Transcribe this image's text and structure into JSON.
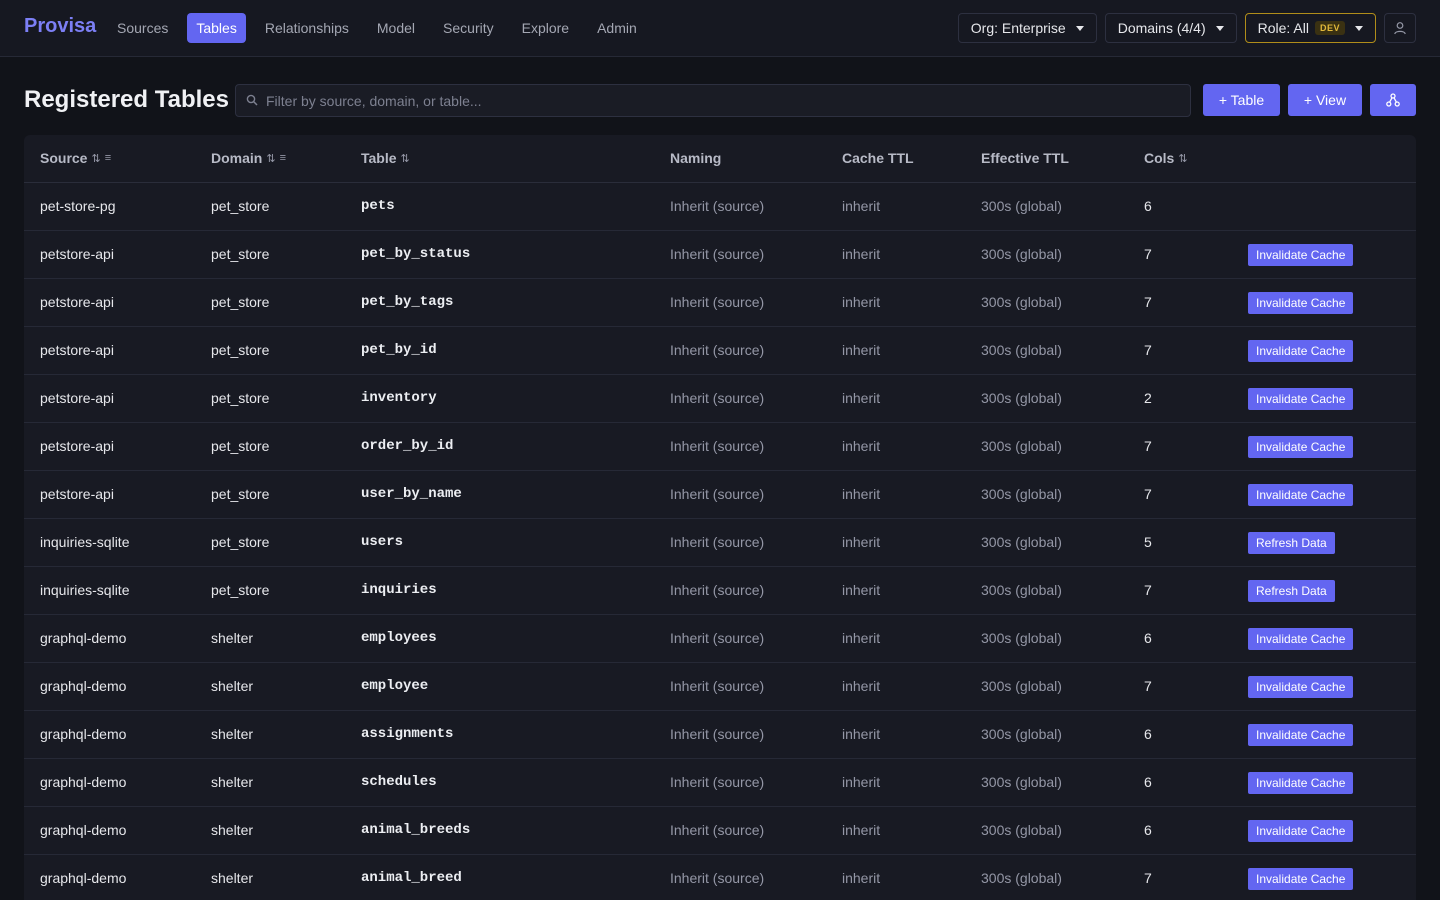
{
  "brand": "Provisa",
  "nav": [
    {
      "label": "Sources",
      "active": false
    },
    {
      "label": "Tables",
      "active": true
    },
    {
      "label": "Relationships",
      "active": false
    },
    {
      "label": "Model",
      "active": false
    },
    {
      "label": "Security",
      "active": false
    },
    {
      "label": "Explore",
      "active": false
    },
    {
      "label": "Admin",
      "active": false
    }
  ],
  "topbar": {
    "org_label": "Org: Enterprise",
    "domains_label": "Domains (4/4)",
    "role_label": "Role: All",
    "env_badge": "DEV"
  },
  "page": {
    "title": "Registered Tables",
    "filter_placeholder": "Filter by source, domain, or table...",
    "add_table_label": "+ Table",
    "add_view_label": "+ View"
  },
  "columns": {
    "source": "Source",
    "domain": "Domain",
    "table": "Table",
    "naming": "Naming",
    "cache_ttl": "Cache TTL",
    "effective_ttl": "Effective TTL",
    "cols": "Cols"
  },
  "rows": [
    {
      "source": "pet-store-pg",
      "domain": "pet_store",
      "table": "pets",
      "naming": "Inherit (source)",
      "cache_ttl": "inherit",
      "effective_ttl": "300s (global)",
      "cols": "6",
      "action": ""
    },
    {
      "source": "petstore-api",
      "domain": "pet_store",
      "table": "pet_by_status",
      "naming": "Inherit (source)",
      "cache_ttl": "inherit",
      "effective_ttl": "300s (global)",
      "cols": "7",
      "action": "Invalidate Cache"
    },
    {
      "source": "petstore-api",
      "domain": "pet_store",
      "table": "pet_by_tags",
      "naming": "Inherit (source)",
      "cache_ttl": "inherit",
      "effective_ttl": "300s (global)",
      "cols": "7",
      "action": "Invalidate Cache"
    },
    {
      "source": "petstore-api",
      "domain": "pet_store",
      "table": "pet_by_id",
      "naming": "Inherit (source)",
      "cache_ttl": "inherit",
      "effective_ttl": "300s (global)",
      "cols": "7",
      "action": "Invalidate Cache"
    },
    {
      "source": "petstore-api",
      "domain": "pet_store",
      "table": "inventory",
      "naming": "Inherit (source)",
      "cache_ttl": "inherit",
      "effective_ttl": "300s (global)",
      "cols": "2",
      "action": "Invalidate Cache"
    },
    {
      "source": "petstore-api",
      "domain": "pet_store",
      "table": "order_by_id",
      "naming": "Inherit (source)",
      "cache_ttl": "inherit",
      "effective_ttl": "300s (global)",
      "cols": "7",
      "action": "Invalidate Cache"
    },
    {
      "source": "petstore-api",
      "domain": "pet_store",
      "table": "user_by_name",
      "naming": "Inherit (source)",
      "cache_ttl": "inherit",
      "effective_ttl": "300s (global)",
      "cols": "7",
      "action": "Invalidate Cache"
    },
    {
      "source": "inquiries-sqlite",
      "domain": "pet_store",
      "table": "users",
      "naming": "Inherit (source)",
      "cache_ttl": "inherit",
      "effective_ttl": "300s (global)",
      "cols": "5",
      "action": "Refresh Data"
    },
    {
      "source": "inquiries-sqlite",
      "domain": "pet_store",
      "table": "inquiries",
      "naming": "Inherit (source)",
      "cache_ttl": "inherit",
      "effective_ttl": "300s (global)",
      "cols": "7",
      "action": "Refresh Data"
    },
    {
      "source": "graphql-demo",
      "domain": "shelter",
      "table": "employees",
      "naming": "Inherit (source)",
      "cache_ttl": "inherit",
      "effective_ttl": "300s (global)",
      "cols": "6",
      "action": "Invalidate Cache"
    },
    {
      "source": "graphql-demo",
      "domain": "shelter",
      "table": "employee",
      "naming": "Inherit (source)",
      "cache_ttl": "inherit",
      "effective_ttl": "300s (global)",
      "cols": "7",
      "action": "Invalidate Cache"
    },
    {
      "source": "graphql-demo",
      "domain": "shelter",
      "table": "assignments",
      "naming": "Inherit (source)",
      "cache_ttl": "inherit",
      "effective_ttl": "300s (global)",
      "cols": "6",
      "action": "Invalidate Cache"
    },
    {
      "source": "graphql-demo",
      "domain": "shelter",
      "table": "schedules",
      "naming": "Inherit (source)",
      "cache_ttl": "inherit",
      "effective_ttl": "300s (global)",
      "cols": "6",
      "action": "Invalidate Cache"
    },
    {
      "source": "graphql-demo",
      "domain": "shelter",
      "table": "animal_breeds",
      "naming": "Inherit (source)",
      "cache_ttl": "inherit",
      "effective_ttl": "300s (global)",
      "cols": "6",
      "action": "Invalidate Cache"
    },
    {
      "source": "graphql-demo",
      "domain": "shelter",
      "table": "animal_breed",
      "naming": "Inherit (source)",
      "cache_ttl": "inherit",
      "effective_ttl": "300s (global)",
      "cols": "7",
      "action": "Invalidate Cache"
    }
  ],
  "colors": {
    "accent": "#6366f1",
    "brand": "#7c7ff5",
    "background": "#111319",
    "dev_badge": "#e2b93b"
  },
  "icons": {
    "search": "search-icon",
    "user": "user-icon",
    "graph": "graph-icon",
    "sort": "sort-icon",
    "column_filter": "column-filter-icon"
  }
}
